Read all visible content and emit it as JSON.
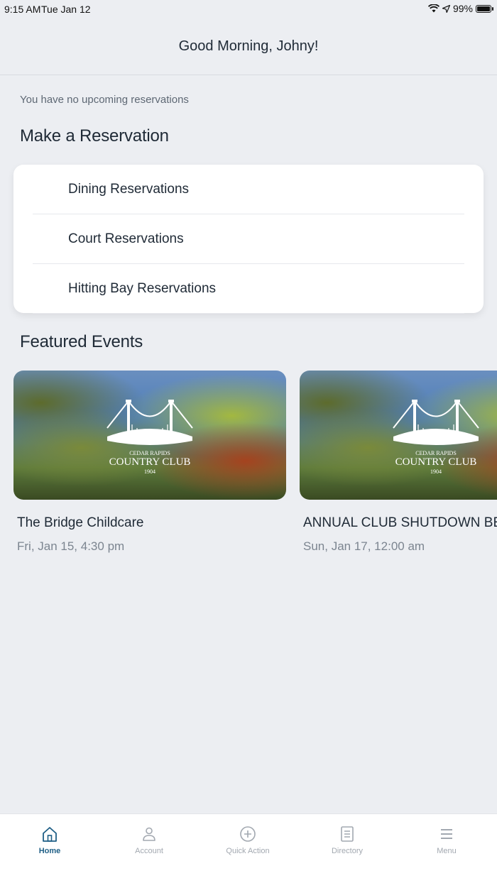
{
  "status_bar": {
    "time": "9:15 AM",
    "date": "Tue Jan 12",
    "battery": "99%"
  },
  "header": {
    "greeting": "Good Morning, Johny!"
  },
  "reservations": {
    "empty_message": "You have no upcoming reservations",
    "section_title": "Make a Reservation",
    "items": [
      {
        "label": "Dining Reservations"
      },
      {
        "label": "Court Reservations"
      },
      {
        "label": "Hitting Bay Reservations"
      }
    ]
  },
  "featured": {
    "section_title": "Featured Events",
    "logo_lines": {
      "top": "CEDAR RAPIDS",
      "main": "COUNTRY CLUB",
      "year": "1904"
    },
    "events": [
      {
        "title": "The Bridge Childcare",
        "date": "Fri, Jan 15, 4:30 pm"
      },
      {
        "title": "ANNUAL CLUB SHUTDOWN BEGINS",
        "date": "Sun, Jan 17, 12:00 am"
      }
    ]
  },
  "tabbar": {
    "active_color": "#1f5f86",
    "inactive_color": "#a2a8b0",
    "tabs": [
      {
        "label": "Home",
        "icon": "home-icon",
        "active": true
      },
      {
        "label": "Account",
        "icon": "user-icon",
        "active": false
      },
      {
        "label": "Quick Action",
        "icon": "plus-circle-icon",
        "active": false
      },
      {
        "label": "Directory",
        "icon": "document-list-icon",
        "active": false
      },
      {
        "label": "Menu",
        "icon": "hamburger-icon",
        "active": false
      }
    ]
  }
}
